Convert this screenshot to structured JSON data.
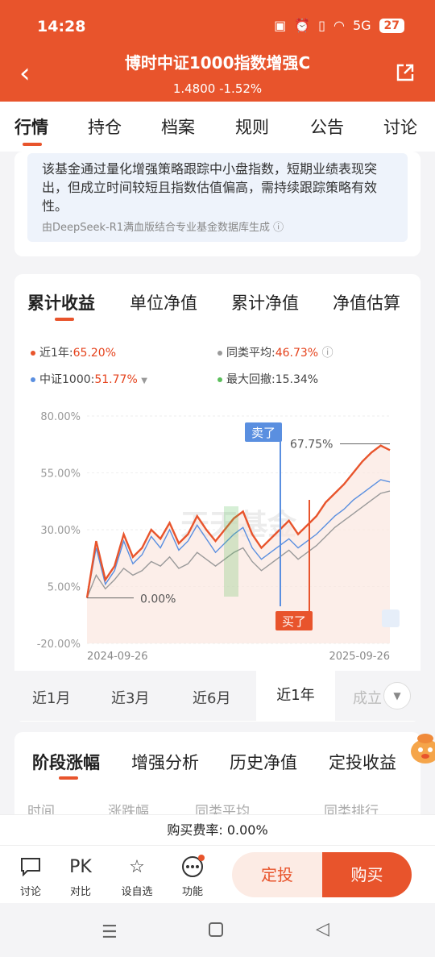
{
  "status": {
    "time": "14:28",
    "battery": "27",
    "signal": "5G"
  },
  "header": {
    "title": "博时中证1000指数增强C",
    "price": "1.4800",
    "change": "-1.52%"
  },
  "tabs": [
    "行情",
    "持仓",
    "档案",
    "规则",
    "公告",
    "讨论"
  ],
  "ai_summary": {
    "text": "该基金通过量化增强策略跟踪中小盘指数，短期业绩表现突出，但成立时间较短且指数估值偏高，需持续跟踪策略有效性。",
    "source": "由DeepSeek-R1满血版结合专业基金数据库生成"
  },
  "chart_tabs": [
    "累计收益",
    "单位净值",
    "累计净值",
    "净值估算"
  ],
  "legend": {
    "fund_label": "近1年:",
    "fund_value": "65.20%",
    "peer_label": "同类平均:",
    "peer_value": "46.73%",
    "index_label": "中证1000:",
    "index_value": "51.77%",
    "drawdown_label": "最大回撤:",
    "drawdown_value": "15.34%"
  },
  "colors": {
    "fund": "#e8542c",
    "index": "#5a8fe0",
    "peer": "#9a9a9a",
    "drawdown": "#5cbf5c"
  },
  "chart_data": {
    "type": "line",
    "x_start": "2024-09-26",
    "x_end": "2025-09-26",
    "ylim": [
      -20,
      80
    ],
    "y_ticks": [
      "80.00%",
      "55.00%",
      "30.00%",
      "5.00%",
      "-20.00%"
    ],
    "annotations": {
      "start_label": "0.00%",
      "peak_label": "67.75%",
      "sell_label": "卖了",
      "buy_label": "买了",
      "watermark": "天天基金"
    },
    "series": [
      {
        "name": "近1年",
        "values": [
          0,
          25,
          8,
          14,
          28,
          18,
          22,
          30,
          26,
          33,
          24,
          28,
          36,
          30,
          25,
          30,
          35,
          38,
          28,
          22,
          26,
          30,
          34,
          28,
          32,
          36,
          42,
          46,
          50,
          55,
          60,
          64,
          67,
          65
        ]
      },
      {
        "name": "中证1000",
        "values": [
          0,
          22,
          6,
          12,
          25,
          15,
          19,
          27,
          22,
          30,
          21,
          25,
          32,
          26,
          20,
          24,
          28,
          31,
          22,
          17,
          20,
          23,
          26,
          22,
          25,
          28,
          32,
          36,
          39,
          43,
          46,
          49,
          52,
          51
        ]
      },
      {
        "name": "同类平均",
        "values": [
          0,
          10,
          4,
          8,
          13,
          10,
          12,
          16,
          14,
          18,
          13,
          15,
          20,
          17,
          14,
          17,
          20,
          22,
          16,
          12,
          15,
          18,
          21,
          17,
          20,
          23,
          27,
          31,
          34,
          37,
          40,
          43,
          46,
          47
        ]
      }
    ]
  },
  "ranges": [
    "近1月",
    "近3月",
    "近6月",
    "近1年",
    "成立"
  ],
  "section_tabs": [
    "阶段涨幅",
    "增强分析",
    "历史净值",
    "定投收益"
  ],
  "table_headers": [
    "时间",
    "涨跌幅",
    "同类平均",
    "同类排行"
  ],
  "fee": "购买费率: 0.00%",
  "bottom_items": [
    "讨论",
    "对比",
    "设自选",
    "功能"
  ],
  "bottom_icons": [
    "chat-icon",
    "pk-icon",
    "star-icon",
    "more-icon"
  ],
  "pk_text": "PK",
  "buttons": {
    "dingtou": "定投",
    "buy": "购买"
  }
}
